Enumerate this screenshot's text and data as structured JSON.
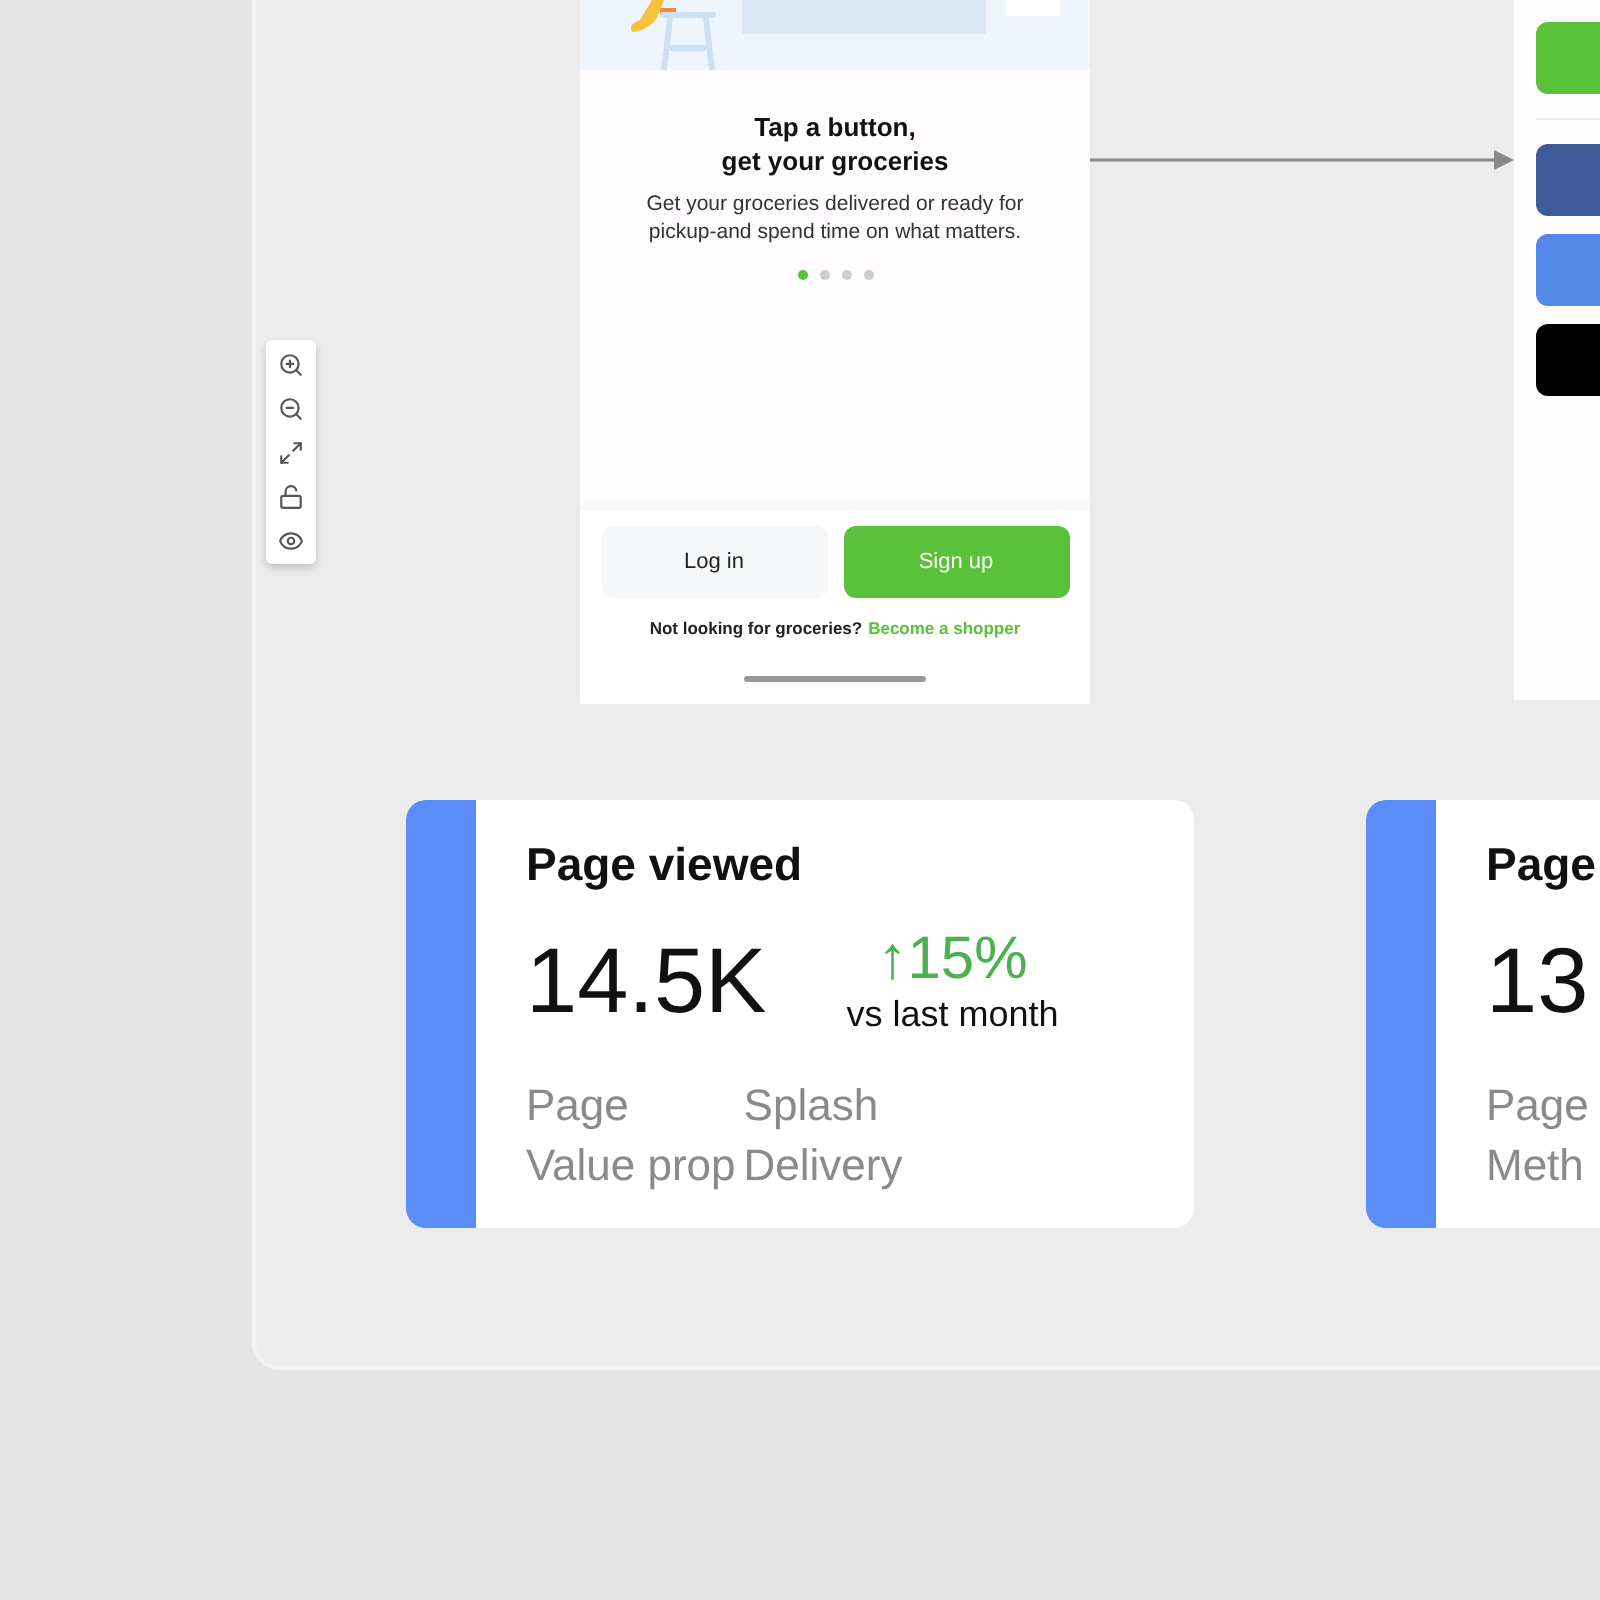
{
  "toolbar": {
    "buttons": [
      {
        "kind": "zoom-in"
      },
      {
        "kind": "zoom-out"
      },
      {
        "kind": "fit"
      },
      {
        "kind": "lock"
      },
      {
        "kind": "view"
      }
    ]
  },
  "phone_screen": {
    "title": "Tap a button,\nget your groceries",
    "description": "Get your groceries delivered or ready for pickup-and spend time on what matters.",
    "pager": [
      {
        "selected": true
      },
      {
        "selected": false
      },
      {
        "selected": false
      },
      {
        "selected": false
      }
    ],
    "buttons": [
      {
        "label": "Log in",
        "kind": "secondary"
      },
      {
        "label": "Sign up",
        "kind": "primary"
      }
    ],
    "footer": {
      "text": "Not looking for groceries?",
      "link": "Become a shopper"
    }
  },
  "side_screen": {
    "buttons": [
      {
        "color": "#5ac13a"
      },
      {
        "color": "#3f5a99"
      },
      {
        "color": "#5387e8"
      },
      {
        "color": "#000000"
      }
    ]
  },
  "cards": [
    {
      "title": "Page viewed",
      "value": "14.5K",
      "change": "↑15%",
      "change_note": "vs last month",
      "rows": [
        [
          "Page",
          "Splash"
        ],
        [
          "Value prop",
          "Delivery"
        ]
      ]
    },
    {
      "title": "Page",
      "value": "13",
      "rows": [
        [
          "Page"
        ],
        [
          "Meth"
        ]
      ]
    }
  ]
}
